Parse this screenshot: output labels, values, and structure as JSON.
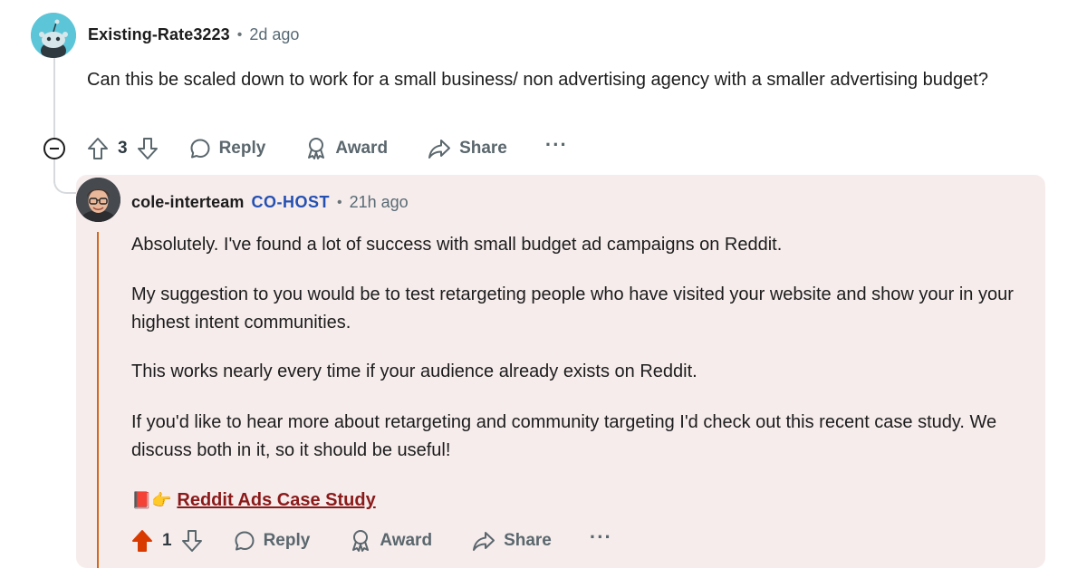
{
  "comment": {
    "author": "Existing-Rate3223",
    "separator": "•",
    "time": "2d ago",
    "body": "Can this be scaled down to work for a small business/ non advertising agency with a smaller advertising budget?",
    "votes": "3",
    "actions": {
      "reply": "Reply",
      "award": "Award",
      "share": "Share",
      "more": "···"
    },
    "avatar_icon": "reddit-snoo-icon",
    "avatar_color": "#5cc5d8"
  },
  "reply": {
    "author": "cole-interteam",
    "badge": "CO-HOST",
    "separator": "•",
    "time": "21h ago",
    "paragraphs": [
      "Absolutely. I've found a lot of success with small budget ad campaigns on Reddit.",
      "My suggestion to you would be to test retargeting people who have visited your website and show your in your highest intent communities.",
      "This works nearly every time if your audience already exists on Reddit.",
      "If you'd like to hear more about retargeting and community targeting I'd check out this recent case study. We discuss both in it, so it should be useful!"
    ],
    "link_emoji": "📕👉",
    "link_text": "Reddit Ads Case Study",
    "votes": "1",
    "upvoted": true,
    "actions": {
      "reply": "Reply",
      "award": "Award",
      "share": "Share",
      "more": "···"
    },
    "card_bg": "#f6ecec",
    "accent_upvote": "#d93a00",
    "badge_color": "#2450b2",
    "link_color": "#8a1a1a"
  }
}
